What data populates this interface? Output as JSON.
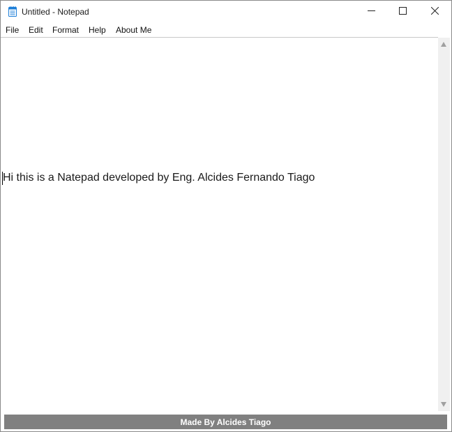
{
  "window": {
    "title": "Untitled - Notepad",
    "app_icon": "notepad-icon",
    "controls": {
      "minimize_icon": "minimize-icon",
      "maximize_icon": "maximize-icon",
      "close_icon": "close-icon"
    }
  },
  "menu": {
    "items": [
      {
        "label": "File"
      },
      {
        "label": "Edit"
      },
      {
        "label": "Format"
      },
      {
        "label": "Help"
      },
      {
        "label": "About Me"
      }
    ]
  },
  "editor": {
    "content": "Hi this is a Natepad developed by Eng. Alcides Fernando Tiago"
  },
  "status": {
    "text": "Made By Alcides Tiago",
    "background_color": "#808080",
    "text_color": "#ffffff"
  },
  "colors": {
    "notepad_icon": "#1e7fd8"
  }
}
